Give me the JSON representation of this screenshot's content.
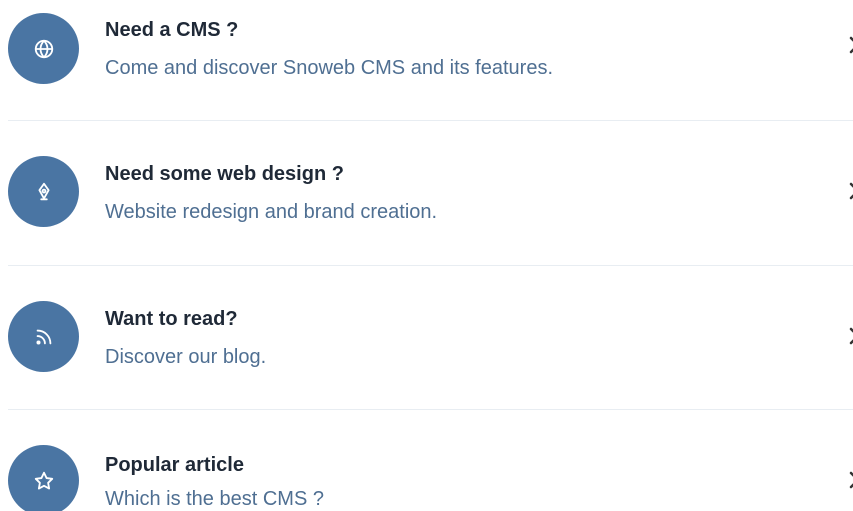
{
  "items": [
    {
      "icon": "globe-icon",
      "title": "Need a CMS ?",
      "description": "Come and discover Snoweb CMS and its features."
    },
    {
      "icon": "pen-tool-icon",
      "title": "Need some web design ?",
      "description": "Website redesign and brand creation."
    },
    {
      "icon": "rss-icon",
      "title": "Want to read?",
      "description": "Discover our blog."
    },
    {
      "icon": "star-icon",
      "title": "Popular article",
      "description": "Which is the best CMS ?"
    }
  ],
  "colors": {
    "icon_background": "#4a75a3",
    "title_text": "#1f2937",
    "description_text": "#4f6f92",
    "divider": "#e8edf2"
  }
}
